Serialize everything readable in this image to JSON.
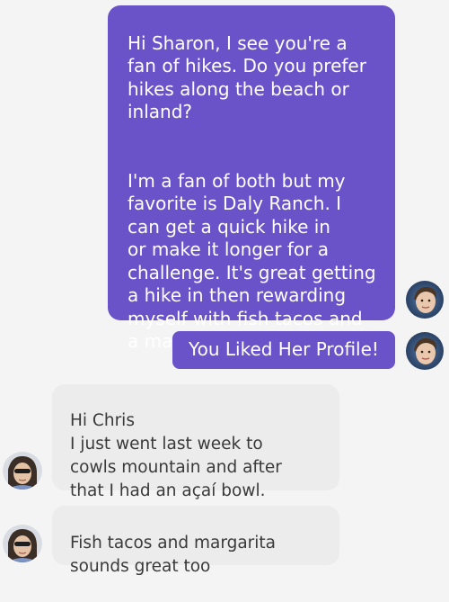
{
  "messages": {
    "sent_1": {
      "para1": "Hi Sharon, I see you're a\nfan of hikes. Do you prefer\nhikes along the beach or\ninland?",
      "para2": "I'm a fan of both but my\nfavorite is Daly Ranch. I\ncan get a quick hike in\nor make it longer for a\nchallenge. It's great getting\na hike in then rewarding\nmyself with fish tacos and\na margarita, right?"
    },
    "sent_2": {
      "text": "You Liked Her Profile!"
    },
    "received_1": {
      "text": "Hi Chris\nI just went last week to\ncowls mountain and after\nthat I had an açaí bowl."
    },
    "received_2": {
      "text": "Fish tacos and margarita\nsounds great too"
    }
  },
  "colors": {
    "sent_bubble": "#6a52c9",
    "received_bubble": "#ececec",
    "background": "#f4f4f4"
  },
  "icons": {
    "sender_avatar": "user-avatar-icon",
    "recipient_avatar": "match-avatar-icon"
  }
}
